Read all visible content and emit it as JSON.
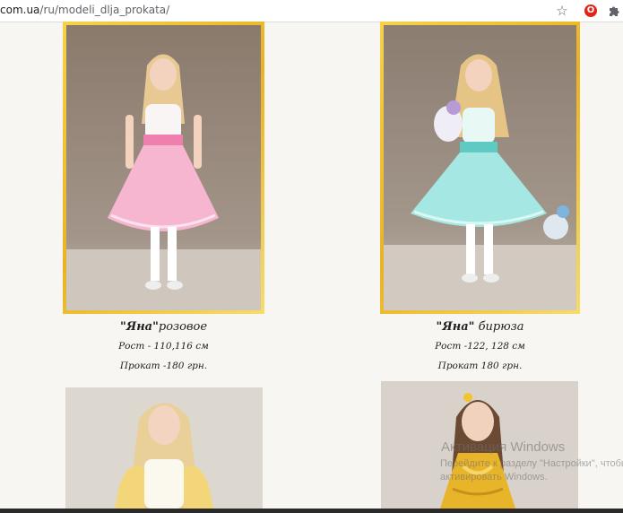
{
  "browser": {
    "url_host": "com.ua",
    "url_path": "/ru/modeli_dlja_prokata/",
    "star_icon": "star-icon",
    "extension_icon": "opera-icon",
    "puzzle_icon": "puzzle-icon"
  },
  "products": [
    {
      "name": "\"Яна\"",
      "color": "розовое",
      "height": "Рост - 110,116 см",
      "rent": "Прокат -180 грн."
    },
    {
      "name": "\"Яна\"",
      "color": " бирюза",
      "height": "Рост -122, 128 см",
      "rent": "Прокат 180 грн."
    }
  ],
  "watermark": {
    "title": "Активация Windows",
    "line1": "Перейдите к разделу \"Настройки\", чтобы",
    "line2": "активировать Windows."
  },
  "colors": {
    "frame_gold": "#e9b323",
    "page_bg": "#f7f6f2",
    "pink_dress": "#f4a9c8",
    "mint_dress": "#9fe3df",
    "gold_dress": "#e8b52a"
  }
}
